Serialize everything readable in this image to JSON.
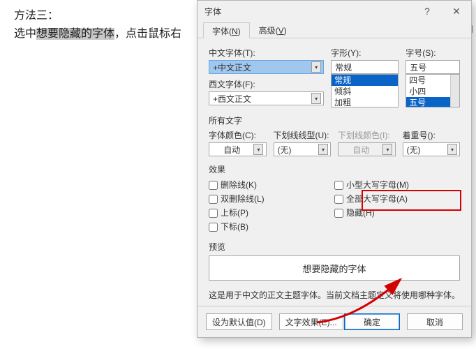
{
  "background": {
    "method_line": "方法三：",
    "line2_prefix": "选中",
    "line2_highlight": "想要隐藏的字体",
    "line2_suffix": "，点击鼠标右",
    "right_fragment": "能即"
  },
  "dialog": {
    "title": "字体",
    "help_btn": "?",
    "close_btn": "✕",
    "tabs": {
      "font": "字体(N)",
      "font_u": "N",
      "adv": "高级(V)",
      "adv_u": "V"
    },
    "cn_font_label": "中文字体(T):",
    "cn_font_value": "+中文正文",
    "ws_font_label": "西文字体(F):",
    "ws_font_value": "+西文正文",
    "style_label": "字形(Y):",
    "style_value": "常规",
    "style_list": [
      "常规",
      "倾斜",
      "加粗"
    ],
    "size_label": "字号(S):",
    "size_value": "五号",
    "size_list": [
      "四号",
      "小四",
      "五号"
    ],
    "all_text_label": "所有文字",
    "font_color_label": "字体颜色(C):",
    "font_color_value": "自动",
    "underline_label": "下划线线型(U):",
    "underline_value": "(无)",
    "ul_color_label": "下划线颜色(I):",
    "ul_color_value": "自动",
    "emphasis_label": "着重号():",
    "emphasis_value": "(无)",
    "effects_label": "效果",
    "cb_strike": "删除线(K)",
    "cb_dstrike": "双删除线(L)",
    "cb_sup": "上标(P)",
    "cb_sub": "下标(B)",
    "cb_smallcaps": "小型大写字母(M)",
    "cb_allcaps": "全部大写字母(A)",
    "cb_hidden": "隐藏(H)",
    "preview_label": "预览",
    "preview_text": "想要隐藏的字体",
    "preview_desc": "这是用于中文的正文主题字体。当前文档主题定义将使用哪种字体。",
    "btn_default": "设为默认值(D)",
    "btn_texteff": "文字效果(E)...",
    "btn_ok": "确定",
    "btn_cancel": "取消"
  }
}
